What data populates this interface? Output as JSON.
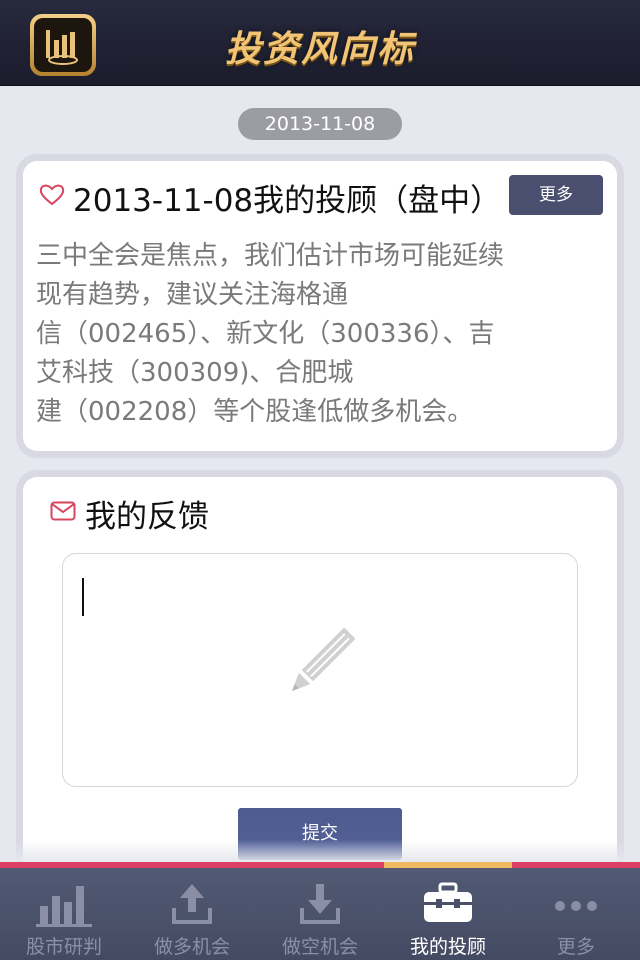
{
  "header": {
    "title": "投资风向标",
    "logo_icon": "stock-chart-logo-icon"
  },
  "date_label": "2013-11-08",
  "advice_card": {
    "icon": "heart-icon",
    "title": "2013-11-08我的投顾（盘中）",
    "more_label": "更多",
    "body_lines": [
      "三中全会是焦点，我们估计市场可能延续",
      "现有趋势，建议关注海格通",
      "信（002465）、新文化（300336）、吉",
      "艾科技（300309)、合肥城",
      "建（002208）等个股逢低做多机会。"
    ]
  },
  "feedback_card": {
    "icon": "mail-icon",
    "title": "我的反馈",
    "input_value": "",
    "input_icon": "pencil-icon",
    "submit_label": "提交"
  },
  "tabbar": {
    "accent_color": "#dc4062",
    "active_color": "#f0b860",
    "tabs": [
      {
        "label": "股市研判",
        "icon": "bar-chart-icon",
        "active": false
      },
      {
        "label": "做多机会",
        "icon": "upload-icon",
        "active": false
      },
      {
        "label": "做空机会",
        "icon": "download-icon",
        "active": false
      },
      {
        "label": "我的投顾",
        "icon": "briefcase-icon",
        "active": true
      },
      {
        "label": "更多",
        "icon": "more-dots-icon",
        "active": false
      }
    ]
  }
}
